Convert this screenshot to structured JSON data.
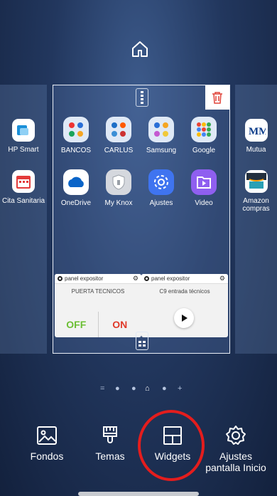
{
  "side_left_apps": [
    "HP Smart",
    "Cita Sanitaria"
  ],
  "side_right_apps": [
    "Mutua",
    "Amazon compras"
  ],
  "main_apps": [
    {
      "label": "BANCOS",
      "icon": "folder-icon",
      "bg": "#dfe9f6"
    },
    {
      "label": "CARLUS",
      "icon": "folder-icon",
      "bg": "#dfe9f6"
    },
    {
      "label": "Samsung",
      "icon": "folder-icon",
      "bg": "#dfe9f6"
    },
    {
      "label": "Google",
      "icon": "folder-icon",
      "bg": "#dfe9f6"
    },
    {
      "label": "OneDrive",
      "icon": "onedrive-icon",
      "bg": "#ffffff"
    },
    {
      "label": "My Knox",
      "icon": "knox-icon",
      "bg": "#d5d8de"
    },
    {
      "label": "Ajustes",
      "icon": "gear-icon",
      "bg": "#3f74f0"
    },
    {
      "label": "Video",
      "icon": "video-icon",
      "bg": "#8f5ff0"
    }
  ],
  "widgets": {
    "left": {
      "title": "panel expositor",
      "subtitle": "PUERTA TECNICOS",
      "off": "OFF",
      "on": "ON"
    },
    "right": {
      "title": "panel expositor",
      "subtitle": "C9 entrada técnicos"
    }
  },
  "indicator": {
    "left": "=",
    "plus": "+"
  },
  "bottom_bar": [
    {
      "label": "Fondos"
    },
    {
      "label": "Temas"
    },
    {
      "label": "Widgets"
    },
    {
      "label": "Ajustes pantalla Inicio"
    }
  ],
  "colors": {
    "accent_red": "#e41d1d",
    "toggle_off": "#6bbf34",
    "toggle_on": "#e03a2a"
  }
}
